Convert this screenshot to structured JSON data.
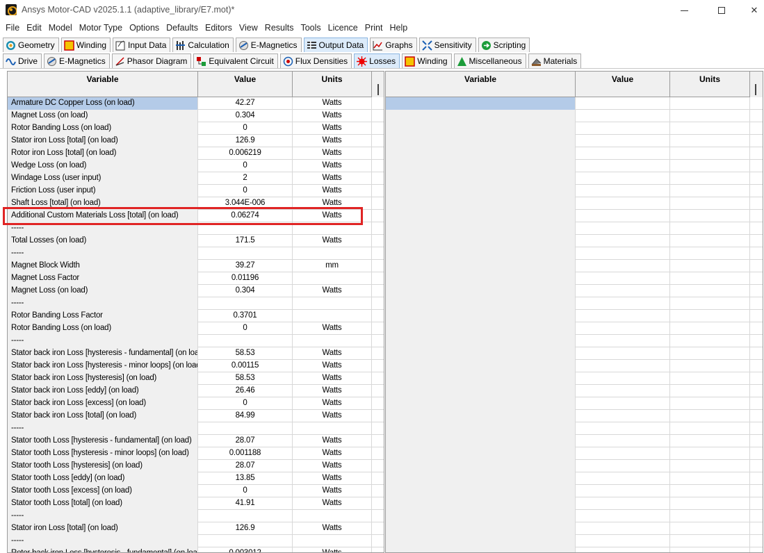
{
  "window": {
    "title": "Ansys Motor-CAD v2025.1.1 (adaptive_library/E7.mot)*",
    "close_glyph": "✕"
  },
  "menu": [
    "File",
    "Edit",
    "Model",
    "Motor Type",
    "Options",
    "Defaults",
    "Editors",
    "View",
    "Results",
    "Tools",
    "Licence",
    "Print",
    "Help"
  ],
  "main_tabs": [
    {
      "label": "Geometry",
      "icon": "geometry-icon"
    },
    {
      "label": "Winding",
      "icon": "winding-icon"
    },
    {
      "label": "Input Data",
      "icon": "input-data-icon"
    },
    {
      "label": "Calculation",
      "icon": "calculation-icon"
    },
    {
      "label": "E-Magnetics",
      "icon": "e-magnetics-icon"
    },
    {
      "label": "Output Data",
      "icon": "output-data-icon",
      "active": true
    },
    {
      "label": "Graphs",
      "icon": "graphs-icon"
    },
    {
      "label": "Sensitivity",
      "icon": "sensitivity-icon"
    },
    {
      "label": "Scripting",
      "icon": "scripting-icon"
    }
  ],
  "sub_tabs": [
    {
      "label": "Drive",
      "icon": "drive-icon"
    },
    {
      "label": "E-Magnetics",
      "icon": "e-magnetics-icon"
    },
    {
      "label": "Phasor Diagram",
      "icon": "phasor-diagram-icon"
    },
    {
      "label": "Equivalent Circuit",
      "icon": "equivalent-circuit-icon"
    },
    {
      "label": "Flux Densities",
      "icon": "flux-densities-icon"
    },
    {
      "label": "Losses",
      "icon": "losses-icon",
      "active": true
    },
    {
      "label": "Winding",
      "icon": "winding-icon"
    },
    {
      "label": "Miscellaneous",
      "icon": "miscellaneous-icon"
    },
    {
      "label": "Materials",
      "icon": "materials-icon"
    }
  ],
  "left_table": {
    "headers": {
      "variable": "Variable",
      "value": "Value",
      "units": "Units"
    },
    "rows": [
      {
        "variable": "Armature DC Copper Loss (on load)",
        "value": "42.27",
        "units": "Watts",
        "selected": true
      },
      {
        "variable": "Magnet Loss (on load)",
        "value": "0.304",
        "units": "Watts"
      },
      {
        "variable": "Rotor Banding Loss (on load)",
        "value": "0",
        "units": "Watts"
      },
      {
        "variable": "Stator iron Loss [total] (on load)",
        "value": "126.9",
        "units": "Watts"
      },
      {
        "variable": "Rotor iron Loss [total] (on load)",
        "value": "0.006219",
        "units": "Watts"
      },
      {
        "variable": "Wedge Loss (on load)",
        "value": "0",
        "units": "Watts"
      },
      {
        "variable": "Windage Loss (user input)",
        "value": "2",
        "units": "Watts"
      },
      {
        "variable": "Friction Loss (user input)",
        "value": "0",
        "units": "Watts"
      },
      {
        "variable": "Shaft Loss [total] (on load)",
        "value": "3.044E-006",
        "units": "Watts"
      },
      {
        "variable": "Additional Custom Materials Loss [total] (on load)",
        "value": "0.06274",
        "units": "Watts"
      },
      {
        "variable": "-----",
        "value": "",
        "units": ""
      },
      {
        "variable": "Total Losses (on load)",
        "value": "171.5",
        "units": "Watts"
      },
      {
        "variable": "-----",
        "value": "",
        "units": ""
      },
      {
        "variable": "Magnet Block Width",
        "value": "39.27",
        "units": "mm"
      },
      {
        "variable": "Magnet Loss Factor",
        "value": "0.01196",
        "units": ""
      },
      {
        "variable": "Magnet Loss (on load)",
        "value": "0.304",
        "units": "Watts"
      },
      {
        "variable": "-----",
        "value": "",
        "units": ""
      },
      {
        "variable": "Rotor Banding Loss Factor",
        "value": "0.3701",
        "units": ""
      },
      {
        "variable": "Rotor Banding Loss (on load)",
        "value": "0",
        "units": "Watts"
      },
      {
        "variable": "-----",
        "value": "",
        "units": ""
      },
      {
        "variable": "Stator back iron Loss [hysteresis - fundamental] (on load)",
        "value": "58.53",
        "units": "Watts"
      },
      {
        "variable": "Stator back iron Loss [hysteresis - minor loops] (on load)",
        "value": "0.00115",
        "units": "Watts"
      },
      {
        "variable": "Stator back iron Loss [hysteresis] (on load)",
        "value": "58.53",
        "units": "Watts"
      },
      {
        "variable": "Stator back iron Loss [eddy] (on load)",
        "value": "26.46",
        "units": "Watts"
      },
      {
        "variable": "Stator back iron Loss [excess] (on load)",
        "value": "0",
        "units": "Watts"
      },
      {
        "variable": "Stator back iron Loss [total] (on load)",
        "value": "84.99",
        "units": "Watts"
      },
      {
        "variable": "-----",
        "value": "",
        "units": ""
      },
      {
        "variable": "Stator tooth Loss [hysteresis - fundamental] (on load)",
        "value": "28.07",
        "units": "Watts"
      },
      {
        "variable": "Stator tooth Loss [hysteresis - minor loops] (on load)",
        "value": "0.001188",
        "units": "Watts"
      },
      {
        "variable": "Stator tooth Loss [hysteresis] (on load)",
        "value": "28.07",
        "units": "Watts"
      },
      {
        "variable": "Stator tooth Loss [eddy] (on load)",
        "value": "13.85",
        "units": "Watts"
      },
      {
        "variable": "Stator tooth Loss [excess] (on load)",
        "value": "0",
        "units": "Watts"
      },
      {
        "variable": "Stator tooth Loss [total] (on load)",
        "value": "41.91",
        "units": "Watts"
      },
      {
        "variable": "-----",
        "value": "",
        "units": ""
      },
      {
        "variable": "Stator iron Loss [total] (on load)",
        "value": "126.9",
        "units": "Watts"
      },
      {
        "variable": "-----",
        "value": "",
        "units": ""
      },
      {
        "variable": "Rotor back iron Loss [hysteresis - fundamental] (on load)",
        "value": "0.003012",
        "units": "Watts"
      }
    ]
  },
  "right_table": {
    "headers": {
      "variable": "Variable",
      "value": "Value",
      "units": "Units"
    }
  },
  "colors": {
    "highlight_box": "#e02424",
    "selected_row": "#b4cbe8",
    "active_tab": "#dcebfa"
  }
}
